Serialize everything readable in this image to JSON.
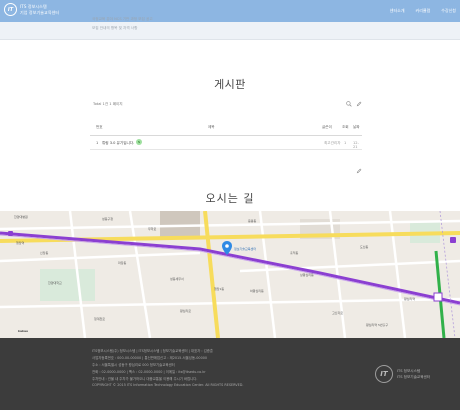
{
  "header": {
    "logo_mark": "IT",
    "brand_line1": "ITS 정보시스템",
    "brand_line2": "기업 정보기술교육센터",
    "nav": [
      "센터소개",
      "커리큘럼",
      "수강신청"
    ]
  },
  "overlay": {
    "line1": "국정교육 분야 NCS 기반 과정 모집 공고",
    "line2": "모집 안내의 항목 및 자격 사항"
  },
  "board": {
    "title": "게시판",
    "total": "Total 1건 1 페이지",
    "columns": [
      "번호",
      "제목",
      "글쓴이",
      "조회",
      "날짜"
    ],
    "rows": [
      {
        "no": "1",
        "title": "튜링 3.0 유기입니다.",
        "writer": "최고관리자",
        "views": "1",
        "date": "12-21"
      }
    ],
    "new_badge": "N"
  },
  "map_section": {
    "title": "오시는 길",
    "marker_label": "정보기술교육센터",
    "labels": [
      "한양대병원",
      "성동구청",
      "응봉동",
      "행당역",
      "왕십리역",
      "마장동",
      "홍익동",
      "도선동",
      "하왕십리동",
      "한양대학교",
      "왕십리로",
      "무학로",
      "고산자로",
      "청계천로",
      "상왕십리동",
      "신당동",
      "왕십리역 5번출구",
      "성동세무서",
      "행당1동",
      "kakao"
    ]
  },
  "footer": {
    "lines": [
      "ITS정보시스템(주) 정보시스템 | ITS정보시스템 | 정보기술교육센터 | 대표자 : 김종훈",
      "사업자등록번호 : 000-00-00000 | 통신판매업신고 : 제2015-서울성동-00000",
      "주소 : 서울특별시 성동구 왕십리로 000 정보기술교육센터",
      "전화 : 02-0000-0000 | 팩스 : 02-0000-0000 | 이메일 : its@itsedu.co.kr",
      "주차안내 : 건물 내 주차가 불가하오니 대중교통을 이용해 주시기 바랍니다.",
      "COPYRIGHT © 2015 ITS Information Technology Education Center. All RIGHTS RESERVED."
    ],
    "brand_line1": "ITS 정보시스템",
    "brand_line2": "ITS 정보기술교육센터"
  }
}
